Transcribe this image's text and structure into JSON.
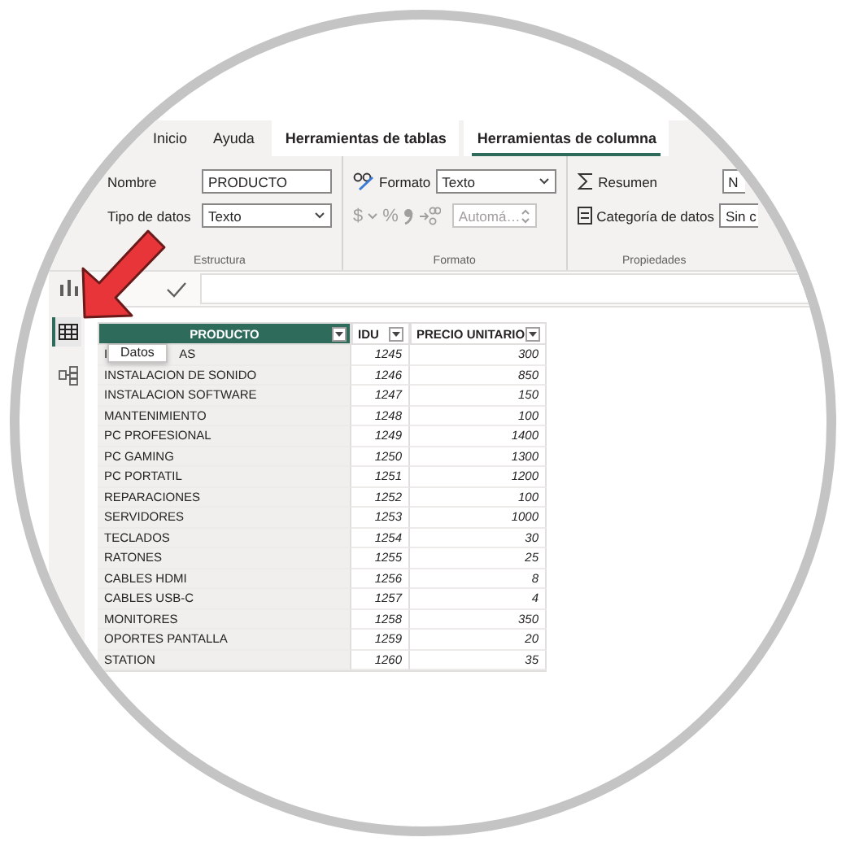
{
  "tabs": [
    {
      "label": "Inicio",
      "kind": "standard",
      "selected": false
    },
    {
      "label": "Ayuda",
      "kind": "standard",
      "selected": false
    },
    {
      "label": "Herramientas de tablas",
      "kind": "contextual",
      "selected": false
    },
    {
      "label": "Herramientas de columna",
      "kind": "contextual",
      "selected": true
    }
  ],
  "ribbon": {
    "structure": {
      "name_label": "Nombre",
      "name_value": "PRODUCTO",
      "type_label": "Tipo de datos",
      "type_value": "Texto",
      "group_label": "Estructura"
    },
    "format": {
      "format_label": "Formato",
      "format_value": "Texto",
      "currency_symbol": "$",
      "percent_symbol": "%",
      "auto_value": "Automá…",
      "disabled": true,
      "group_label": "Formato"
    },
    "properties": {
      "summary_label": "Resumen",
      "summary_value": "N",
      "category_label": "Categoría de datos",
      "category_value": "Sin c",
      "group_label": "Propiedades"
    }
  },
  "sidebar": {
    "items": [
      {
        "kind": "report",
        "selected": false
      },
      {
        "kind": "data",
        "selected": true
      },
      {
        "kind": "model",
        "selected": false
      }
    ]
  },
  "tooltip": "Datos",
  "table": {
    "columns": [
      {
        "label": "PRODUCTO",
        "selected": true
      },
      {
        "label": "IDU",
        "selected": false
      },
      {
        "label": "PRECIO UNITARIO",
        "selected": false
      }
    ],
    "rows": [
      {
        "product": "I",
        "product_tail": "AS",
        "idu": "1245",
        "price": "300"
      },
      {
        "product": "INSTALACION DE SONIDO",
        "idu": "1246",
        "price": "850"
      },
      {
        "product": "INSTALACION SOFTWARE",
        "idu": "1247",
        "price": "150"
      },
      {
        "product": "MANTENIMIENTO",
        "idu": "1248",
        "price": "100"
      },
      {
        "product": "PC PROFESIONAL",
        "idu": "1249",
        "price": "1400"
      },
      {
        "product": "PC GAMING",
        "idu": "1250",
        "price": "1300"
      },
      {
        "product": "PC PORTATIL",
        "idu": "1251",
        "price": "1200"
      },
      {
        "product": "REPARACIONES",
        "idu": "1252",
        "price": "100"
      },
      {
        "product": "SERVIDORES",
        "idu": "1253",
        "price": "1000"
      },
      {
        "product": "TECLADOS",
        "idu": "1254",
        "price": "30"
      },
      {
        "product": "RATONES",
        "idu": "1255",
        "price": "25"
      },
      {
        "product": "CABLES HDMI",
        "idu": "1256",
        "price": "8"
      },
      {
        "product": "CABLES USB-C",
        "idu": "1257",
        "price": "4"
      },
      {
        "product": "MONITORES",
        "idu": "1258",
        "price": "350"
      },
      {
        "product": "OPORTES PANTALLA",
        "idu": "1259",
        "price": "20"
      },
      {
        "product": "STATION",
        "idu": "1260",
        "price": "35"
      }
    ]
  }
}
